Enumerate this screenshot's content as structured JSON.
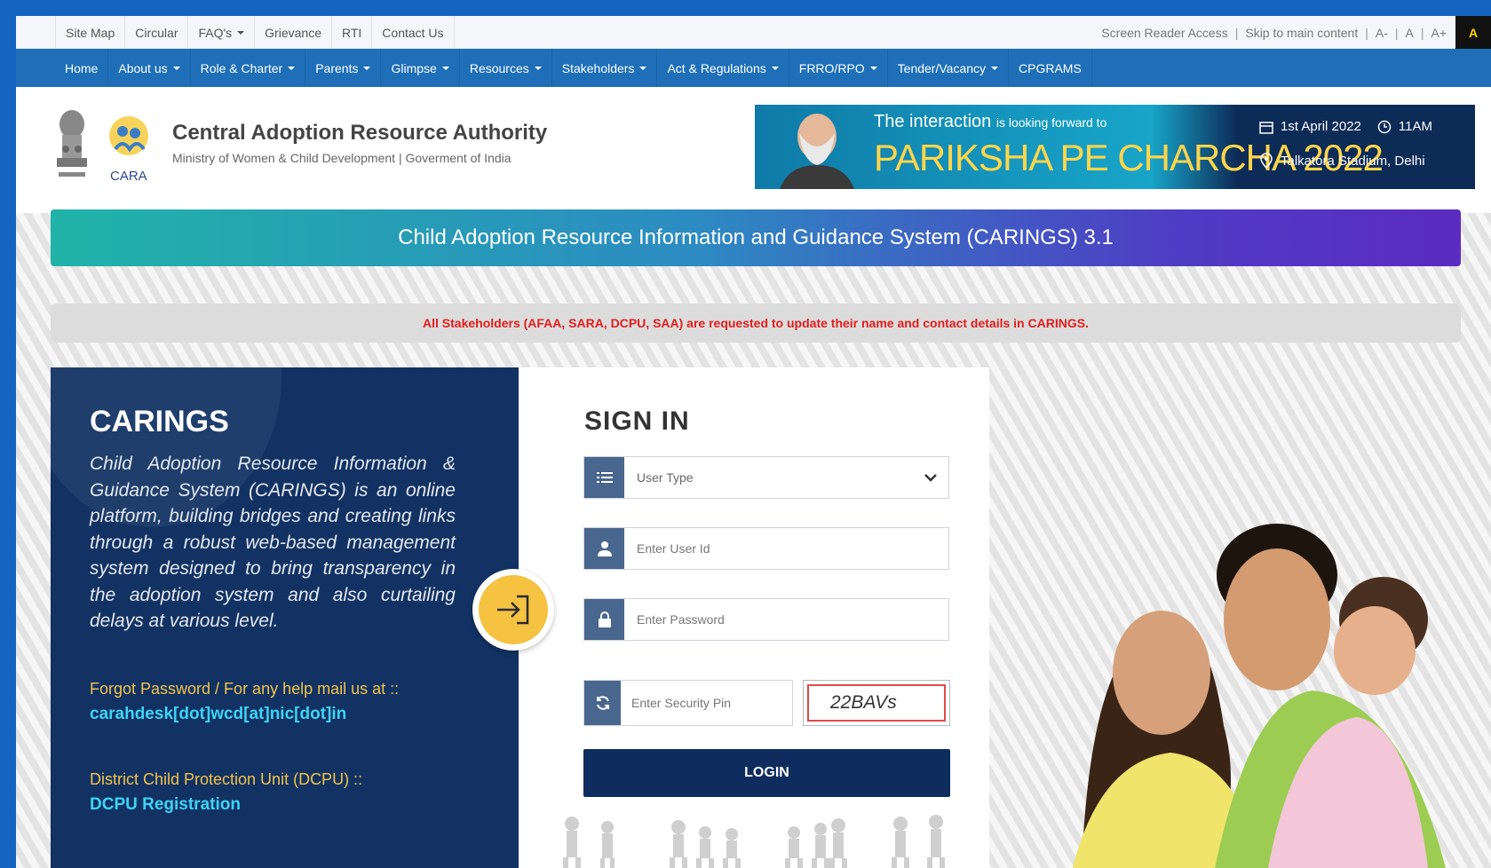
{
  "util_links": [
    "Site Map",
    "Circular",
    "FAQ's",
    "Grievance",
    "RTI",
    "Contact Us"
  ],
  "util_right": {
    "screen_reader": "Screen Reader Access",
    "skip": "Skip to main content",
    "font_dec": "A-",
    "font_norm": "A",
    "font_inc": "A+",
    "contrast": "A"
  },
  "nav": [
    {
      "label": "Home",
      "caret": false
    },
    {
      "label": "About us",
      "caret": true
    },
    {
      "label": "Role & Charter",
      "caret": true
    },
    {
      "label": "Parents",
      "caret": true
    },
    {
      "label": "Glimpse",
      "caret": true
    },
    {
      "label": "Resources",
      "caret": true
    },
    {
      "label": "Stakeholders",
      "caret": true
    },
    {
      "label": "Act & Regulations",
      "caret": true
    },
    {
      "label": "FRRO/RPO",
      "caret": true
    },
    {
      "label": "Tender/Vacancy",
      "caret": true
    },
    {
      "label": "CPGRAMS",
      "caret": false
    }
  ],
  "header": {
    "logo_text": "CARA",
    "org_name": "Central Adoption Resource Authority",
    "org_sub": "Ministry of Women & Child Development | Goverment of India"
  },
  "banner": {
    "line1": "The interaction",
    "line1_small": "is looking forward to",
    "title": "PARIKSHA PE CHARCHA 2022",
    "date": "1st April 2022",
    "time": "11AM",
    "venue": "Talkatora Stadium, Delhi"
  },
  "title_bar": "Child Adoption Resource Information and Guidance System (CARINGS) 3.1",
  "notice": "All Stakeholders (AFAA, SARA, DCPU, SAA) are requested to update their name and contact details in CARINGS.",
  "left_panel": {
    "title": "CARINGS",
    "description": "Child Adoption Resource Information & Guidance System (CARINGS) is an online platform, building bridges and creating links through a robust web-based management system designed to bring transparency in the adoption system and also curtailing delays at various level.",
    "forgot": "Forgot Password / For any help mail us at ::",
    "email": "carahdesk[dot]wcd[at]nic[dot]in",
    "dcpu": "District Child Protection Unit (DCPU) ::",
    "dcpu_link": "DCPU Registration"
  },
  "sign_in": {
    "title": "SIGN IN",
    "user_type": "User Type",
    "user_id_placeholder": "Enter User Id",
    "password_placeholder": "Enter Password",
    "pin_placeholder": "Enter Security Pin",
    "captcha": "22BAVs",
    "login": "LOGIN"
  },
  "colors": {
    "frame": "#1565c0",
    "nav": "#1e6fb8",
    "panel": "#123263",
    "accent_yellow": "#f5c242",
    "link_cyan": "#3fd3f5",
    "notice_red": "#e21d1d"
  }
}
